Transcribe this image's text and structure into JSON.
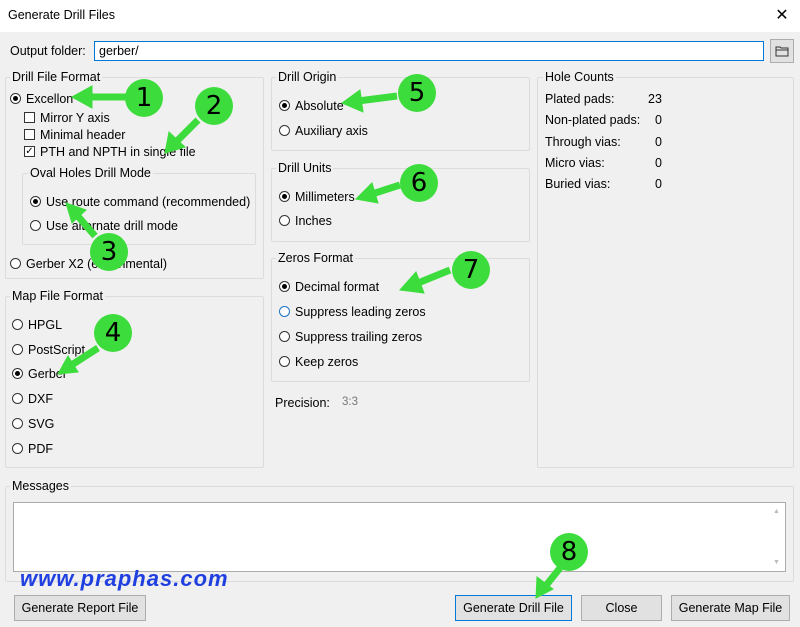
{
  "window": {
    "title": "Generate Drill Files"
  },
  "output_folder": {
    "label": "Output folder:",
    "value": "gerber/"
  },
  "drill_file_format": {
    "title": "Drill File Format",
    "excellon": "Excellon",
    "mirror_y": "Mirror Y axis",
    "minimal_header": "Minimal header",
    "pth_npth": "PTH and NPTH in single file",
    "gerber_x2": "Gerber X2 (experimental)"
  },
  "oval_holes": {
    "title": "Oval Holes Drill Mode",
    "route": "Use route command (recommended)",
    "alternate": "Use alternate drill mode"
  },
  "map_file_format": {
    "title": "Map File Format",
    "options": [
      "HPGL",
      "PostScript",
      "Gerber",
      "DXF",
      "SVG",
      "PDF"
    ],
    "selected": "Gerber"
  },
  "drill_origin": {
    "title": "Drill Origin",
    "absolute": "Absolute",
    "auxiliary": "Auxiliary axis"
  },
  "drill_units": {
    "title": "Drill Units",
    "mm": "Millimeters",
    "inches": "Inches"
  },
  "zeros_format": {
    "title": "Zeros Format",
    "decimal": "Decimal format",
    "suppress_leading": "Suppress leading zeros",
    "suppress_trailing": "Suppress trailing zeros",
    "keep": "Keep zeros"
  },
  "precision": {
    "label": "Precision:",
    "value": "3:3"
  },
  "hole_counts": {
    "title": "Hole Counts",
    "rows": [
      {
        "label": "Plated pads:",
        "value": "23"
      },
      {
        "label": "Non-plated pads:",
        "value": "0"
      },
      {
        "label": "Through vias:",
        "value": "0"
      },
      {
        "label": "Micro vias:",
        "value": "0"
      },
      {
        "label": "Buried vias:",
        "value": "0"
      }
    ]
  },
  "messages": {
    "title": "Messages"
  },
  "buttons": {
    "report": "Generate Report File",
    "drill": "Generate Drill File",
    "close": "Close",
    "map": "Generate Map File"
  },
  "watermark": "www.praphas.com",
  "annotations": [
    "1",
    "2",
    "3",
    "4",
    "5",
    "6",
    "7",
    "8"
  ],
  "colors": {
    "annotation_green": "#3ddc3d",
    "watermark_blue": "#1f3fe0",
    "focus_blue": "#0078d7"
  },
  "icons": {
    "folder": "folder-icon",
    "close": "close-icon"
  }
}
